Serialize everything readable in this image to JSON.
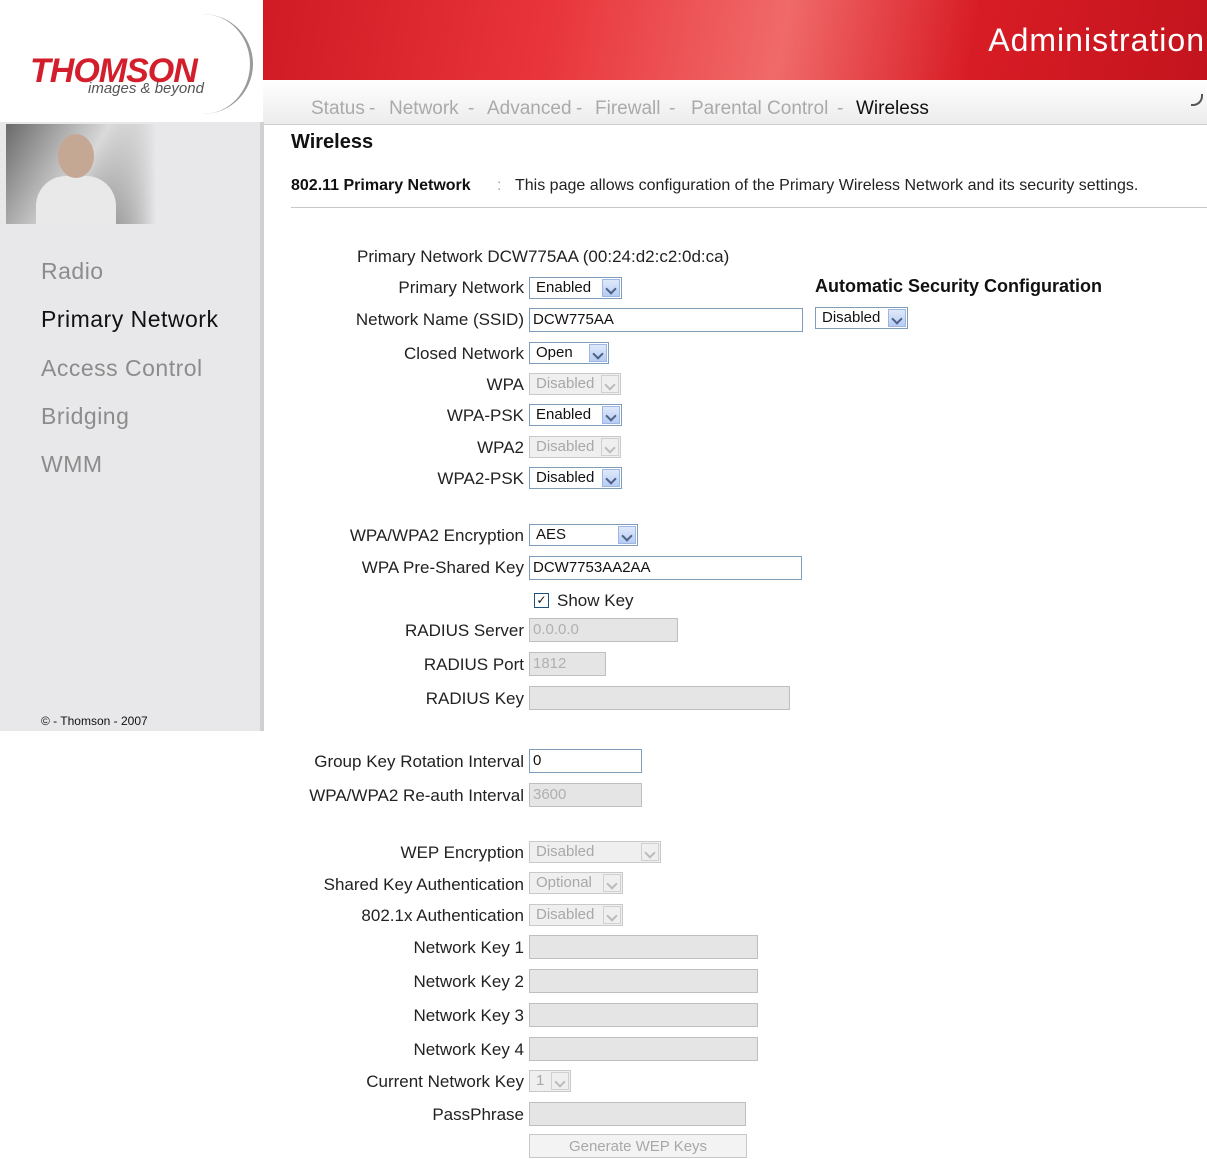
{
  "brand": {
    "name": "THOMSON",
    "tagline": "images & beyond"
  },
  "header": {
    "title": "Administration"
  },
  "nav": {
    "items": [
      "Status",
      "Network",
      "Advanced",
      "Firewall",
      "Parental Control",
      "Wireless"
    ],
    "separator": "-",
    "active": "Wireless"
  },
  "sidebar": {
    "items": [
      "Radio",
      "Primary Network",
      "Access Control",
      "Bridging",
      "WMM"
    ],
    "active": "Primary Network",
    "copyright": "© - Thomson - 2007"
  },
  "page": {
    "title": "Wireless",
    "desc_head": "802.11 Primary Network",
    "desc_sep": ":",
    "desc_text": "This page allows configuration of the Primary Wireless Network and its security settings."
  },
  "form": {
    "network_info": "Primary Network DCW775AA (00:24:d2:c2:0d:ca)",
    "primary_network": {
      "label": "Primary Network",
      "value": "Enabled"
    },
    "ssid": {
      "label": "Network Name (SSID)",
      "value": "DCW775AA"
    },
    "closed_network": {
      "label": "Closed Network",
      "value": "Open"
    },
    "wpa": {
      "label": "WPA",
      "value": "Disabled"
    },
    "wpa_psk": {
      "label": "WPA-PSK",
      "value": "Enabled"
    },
    "wpa2": {
      "label": "WPA2",
      "value": "Disabled"
    },
    "wpa2_psk": {
      "label": "WPA2-PSK",
      "value": "Disabled"
    },
    "encryption": {
      "label": "WPA/WPA2 Encryption",
      "value": "AES"
    },
    "psk": {
      "label": "WPA Pre-Shared Key",
      "value": "DCW7753AA2AA"
    },
    "show_key": {
      "label": "Show Key",
      "checked": "✓"
    },
    "radius_server": {
      "label": "RADIUS Server",
      "value": "0.0.0.0"
    },
    "radius_port": {
      "label": "RADIUS Port",
      "value": "1812"
    },
    "radius_key": {
      "label": "RADIUS Key",
      "value": ""
    },
    "group_key": {
      "label": "Group Key Rotation Interval",
      "value": "0"
    },
    "reauth": {
      "label": "WPA/WPA2 Re-auth Interval",
      "value": "3600"
    },
    "wep_encryption": {
      "label": "WEP Encryption",
      "value": "Disabled"
    },
    "shared_key_auth": {
      "label": "Shared Key Authentication",
      "value": "Optional"
    },
    "auth_8021x": {
      "label": "802.1x Authentication",
      "value": "Disabled"
    },
    "key1": {
      "label": "Network Key 1",
      "value": ""
    },
    "key2": {
      "label": "Network Key 2",
      "value": ""
    },
    "key3": {
      "label": "Network Key 3",
      "value": ""
    },
    "key4": {
      "label": "Network Key 4",
      "value": ""
    },
    "current_key": {
      "label": "Current Network Key",
      "value": "1"
    },
    "passphrase": {
      "label": "PassPhrase",
      "value": ""
    },
    "generate_button": "Generate WEP Keys"
  },
  "auto_security": {
    "title": "Automatic Security Configuration",
    "value": "Disabled"
  },
  "colors": {
    "brand_red": "#d21f2b",
    "header_red": "#d01a24"
  }
}
